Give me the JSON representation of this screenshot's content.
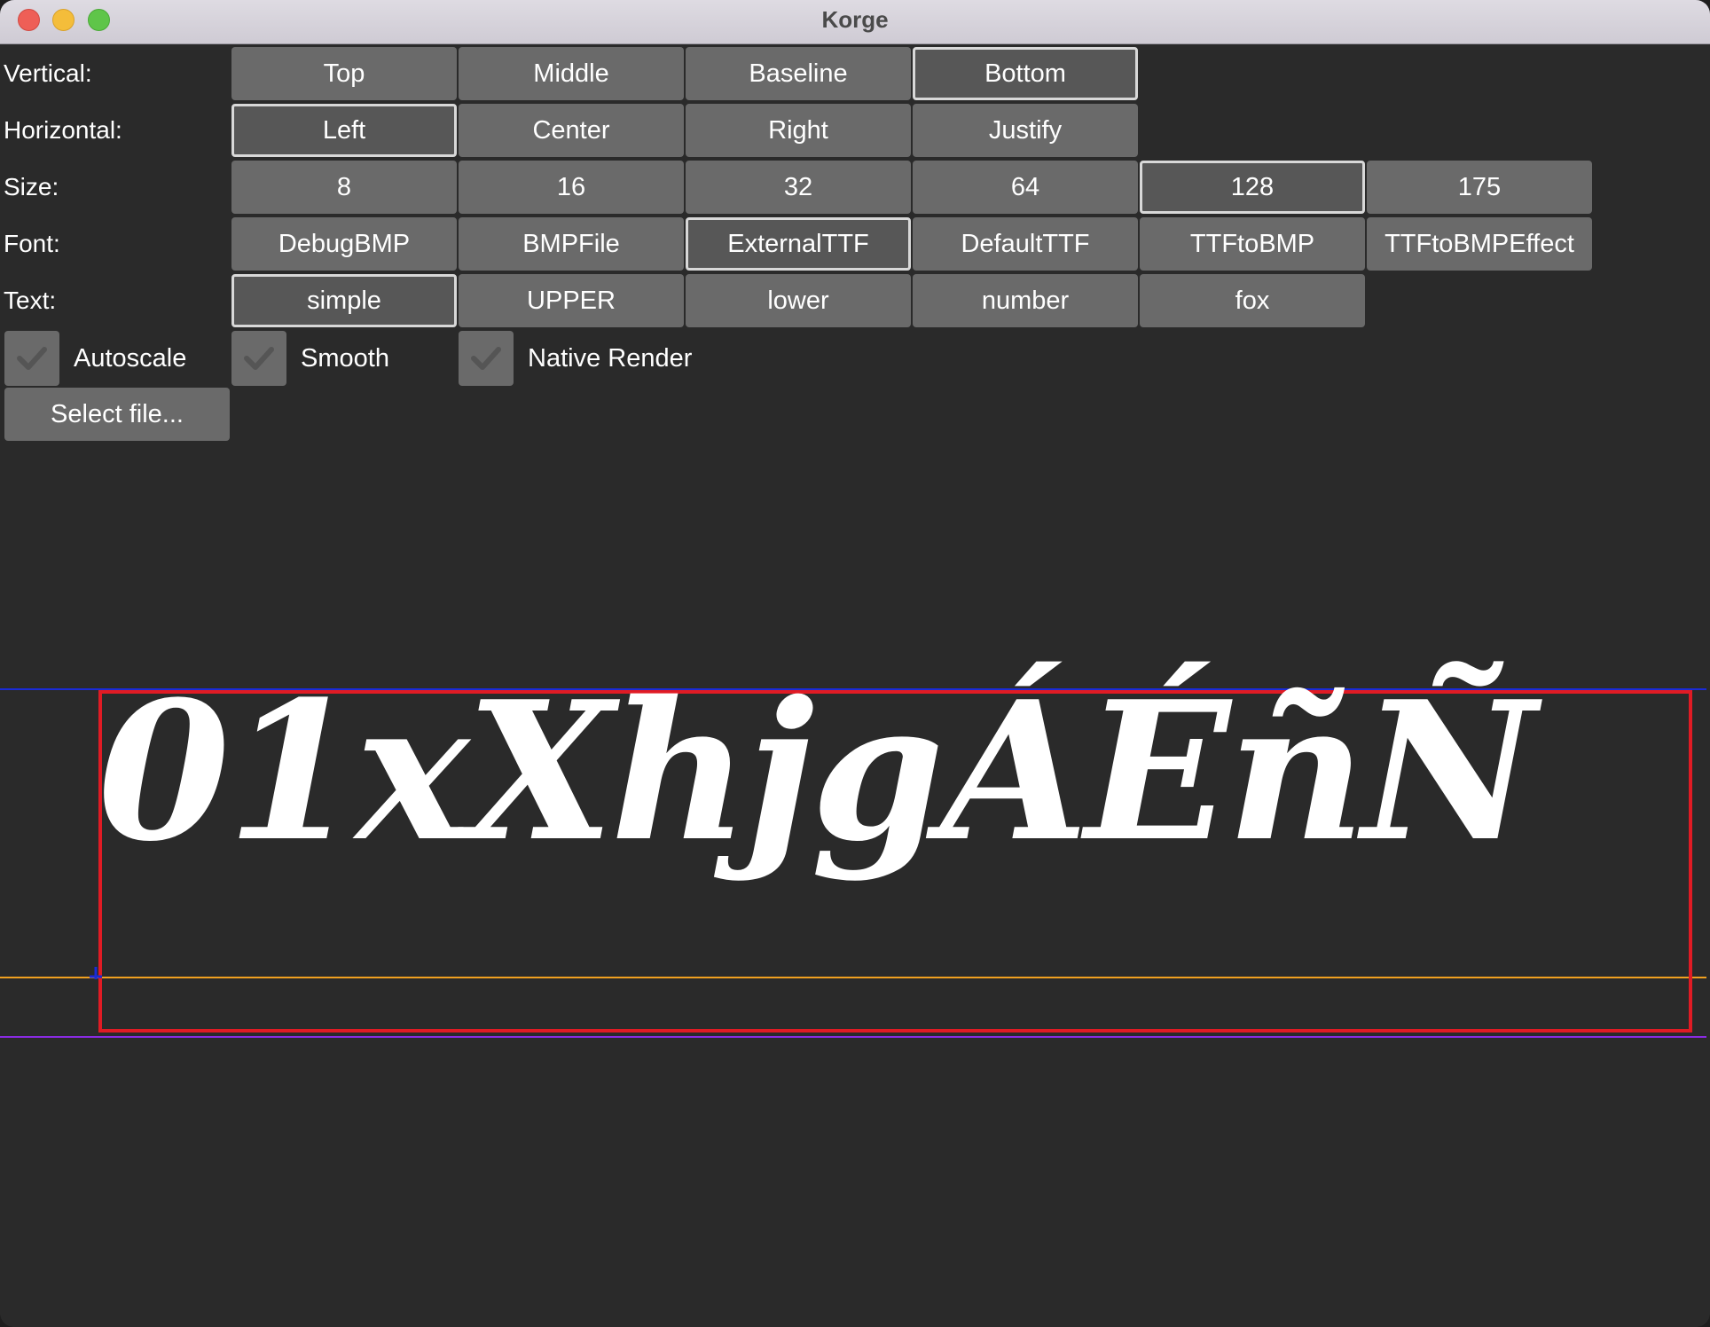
{
  "window": {
    "title": "Korge"
  },
  "vertical": {
    "label": "Vertical:",
    "options": [
      "Top",
      "Middle",
      "Baseline",
      "Bottom"
    ],
    "selected": "Bottom"
  },
  "horizontal": {
    "label": "Horizontal:",
    "options": [
      "Left",
      "Center",
      "Right",
      "Justify"
    ],
    "selected": "Left"
  },
  "size": {
    "label": "Size:",
    "options": [
      "8",
      "16",
      "32",
      "64",
      "128",
      "175"
    ],
    "selected": "128"
  },
  "font": {
    "label": "Font:",
    "options": [
      "DebugBMP",
      "BMPFile",
      "ExternalTTF",
      "DefaultTTF",
      "TTFtoBMP",
      "TTFtoBMPEffect"
    ],
    "selected": "ExternalTTF"
  },
  "text": {
    "label": "Text:",
    "options": [
      "simple",
      "UPPER",
      "lower",
      "number",
      "fox"
    ],
    "selected": "simple"
  },
  "checkboxes": {
    "autoscale": {
      "label": "Autoscale",
      "checked": true
    },
    "smooth": {
      "label": "Smooth",
      "checked": true
    },
    "native_render": {
      "label": "Native Render",
      "checked": true
    }
  },
  "select_file": {
    "label": "Select file..."
  },
  "preview": {
    "text": "01xXhjgÁÉñÑ",
    "guide_colors": {
      "top": "#1a2bd6",
      "bounds": "#e01b24",
      "baseline": "#f0a020",
      "bottom": "#8a2be2"
    }
  }
}
